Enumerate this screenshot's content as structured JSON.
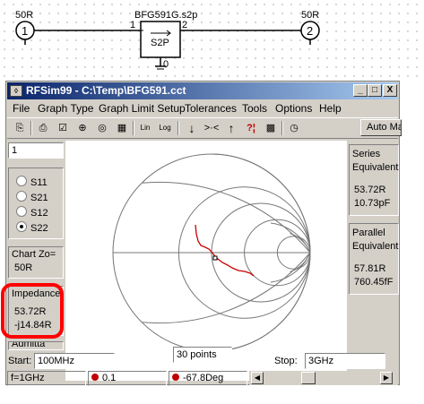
{
  "schematic": {
    "port1_label": "50R",
    "port1_number": "1",
    "port2_label": "50R",
    "port2_number": "2",
    "component_name": "BFG591G.s2p",
    "component_text": "S2P",
    "pin1": "1",
    "pin2": "2",
    "pin0": "0"
  },
  "window": {
    "title": "RFSim99 - C:\\Temp\\BFG591.cct",
    "minimize": "_",
    "maximize": "□",
    "close": "X"
  },
  "menu": [
    "File",
    "Graph Type",
    "Graph Limit Setup",
    "Tolerances",
    "Tools",
    "Options",
    "Help"
  ],
  "toolbar": {
    "auto_match": "Auto Mat",
    "lin": "Lin",
    "log": "Log"
  },
  "left_panel": {
    "index_value": "1",
    "params": [
      "S11",
      "S21",
      "S12",
      "S22"
    ],
    "selected_param": "S22",
    "chart_zo_label": "Chart Zo=",
    "chart_zo_value": "50R",
    "impedance_label": "Impedance",
    "impedance_r": "53.72R",
    "impedance_x": "-j14.84R",
    "admittance_label": "Admitta"
  },
  "right_panel": {
    "series_label": "Series",
    "equivalent_label": "Equivalent",
    "series_r": "53.72R",
    "series_c": "10.73pF",
    "parallel_label": "Parallel",
    "parallel_equivalent": "Equivalent",
    "parallel_r": "57.81R",
    "parallel_c": "760.45fF"
  },
  "bottom": {
    "start_label": "Start:",
    "start_value": "100MHz",
    "points_value": "30 points",
    "stop_label": "Stop:",
    "stop_value": "3GHz"
  },
  "status": {
    "freq": "f=1GHz",
    "magnitude": "0.1",
    "angle": "-67.8Deg"
  },
  "colors": {
    "trace": "#cc0000",
    "highlight": "#ff0000",
    "titlebar": "#0a246a"
  }
}
